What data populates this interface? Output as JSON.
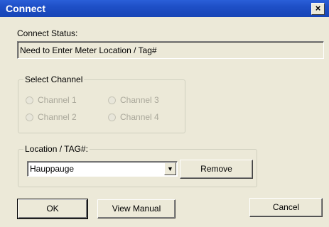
{
  "window": {
    "title": "Connect",
    "close_label": "×"
  },
  "status": {
    "label": "Connect Status:",
    "value": "Need to Enter Meter Location / Tag#"
  },
  "channel_group": {
    "legend": "Select Channel",
    "options": [
      "Channel 1",
      "Channel 3",
      "Channel 2",
      "Channel 4"
    ],
    "enabled": false
  },
  "location_group": {
    "legend": "Location / TAG#:",
    "value": "Hauppauge",
    "dropdown_icon": "chevron-down-icon"
  },
  "buttons": {
    "remove": "Remove",
    "ok": "OK",
    "view_manual": "View Manual",
    "cancel": "Cancel"
  }
}
